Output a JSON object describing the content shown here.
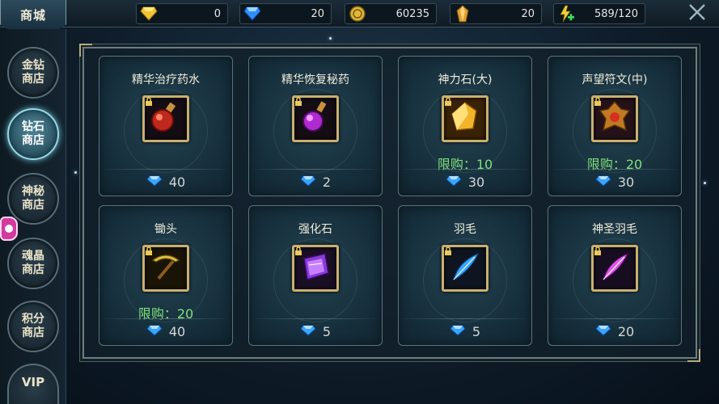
{
  "header": {
    "title": "商城",
    "resources": [
      {
        "icon": "yellow-diamond-icon",
        "value": "0"
      },
      {
        "icon": "blue-diamond-icon",
        "value": "20"
      },
      {
        "icon": "gold-coin-icon",
        "value": "60235"
      },
      {
        "icon": "amber-crystal-icon",
        "value": "20"
      },
      {
        "icon": "energy-plus-icon",
        "value": "589/120"
      }
    ]
  },
  "sidebar": {
    "items": [
      {
        "label": "金钻商店",
        "active": false
      },
      {
        "label": "钻石商店",
        "active": true
      },
      {
        "label": "神秘商店",
        "active": false
      },
      {
        "label": "魂晶商店",
        "active": false
      },
      {
        "label": "积分商店",
        "active": false
      }
    ],
    "vip_label": "VIP"
  },
  "shop": {
    "items": [
      {
        "name": "精华治疗药水",
        "icon": "red-potion-icon",
        "limit": "",
        "price": "40"
      },
      {
        "name": "精华恢复秘药",
        "icon": "purple-potion-icon",
        "limit": "",
        "price": "2"
      },
      {
        "name": "神力石(大)",
        "icon": "yellow-crystal-icon",
        "limit": "限购：10",
        "price": "30"
      },
      {
        "name": "声望符文(中)",
        "icon": "rune-icon",
        "limit": "限购：20",
        "price": "30"
      },
      {
        "name": "锄头",
        "icon": "pickaxe-icon",
        "limit": "限购：20",
        "price": "40"
      },
      {
        "name": "强化石",
        "icon": "enhance-stone-icon",
        "limit": "",
        "price": "5"
      },
      {
        "name": "羽毛",
        "icon": "blue-feather-icon",
        "limit": "",
        "price": "5"
      },
      {
        "name": "神圣羽毛",
        "icon": "pink-feather-icon",
        "limit": "",
        "price": "20"
      }
    ]
  },
  "colors": {
    "accent": "#9ad8e6",
    "gold_border": "#c9b071",
    "limit_green": "#7fe07a",
    "diamond_blue": "#3aa6ff"
  }
}
